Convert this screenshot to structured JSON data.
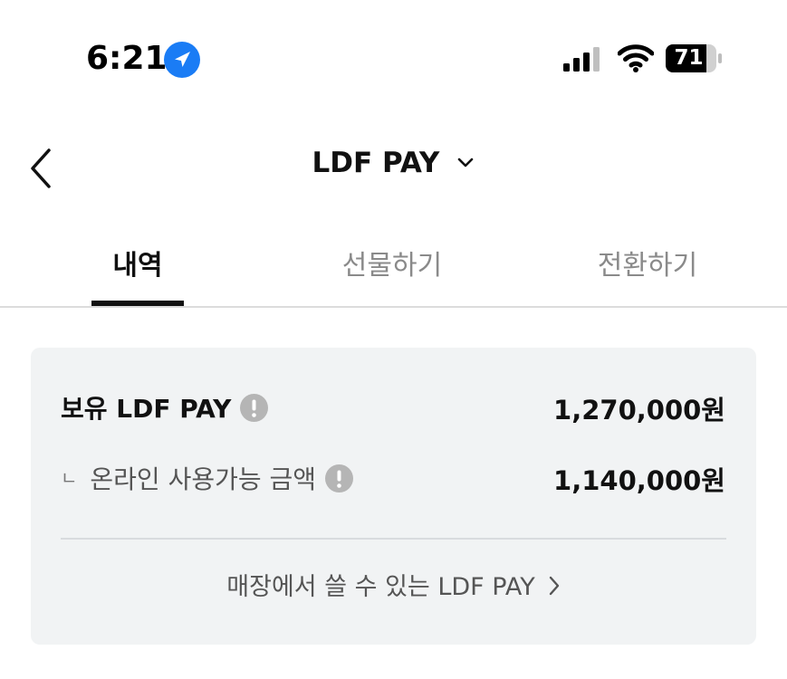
{
  "status_bar": {
    "time": "6:21",
    "battery": "71",
    "icons": [
      "location-arrow-icon",
      "cellular-signal-icon",
      "wifi-icon",
      "battery-icon"
    ]
  },
  "nav": {
    "title": "LDF PAY",
    "icons": [
      "back-chevron-icon",
      "chevron-down-icon"
    ]
  },
  "tabs": [
    {
      "label": "내역",
      "active": true
    },
    {
      "label": "선물하기",
      "active": false
    },
    {
      "label": "전환하기",
      "active": false
    }
  ],
  "balance": {
    "held_label": "보유 LDF PAY",
    "held_value": "1,270,000원",
    "online_prefix": "ㄴ",
    "online_label": "온라인 사용가능 금액",
    "online_value": "1,140,000원",
    "store_link": "매장에서 쓸 수 있는 LDF PAY"
  },
  "colors": {
    "accent_blue": "#1a7cf5",
    "card_bg": "#f1f3f4",
    "info_icon": "#b5b5b5",
    "inactive_tab": "#8a8a8a"
  }
}
